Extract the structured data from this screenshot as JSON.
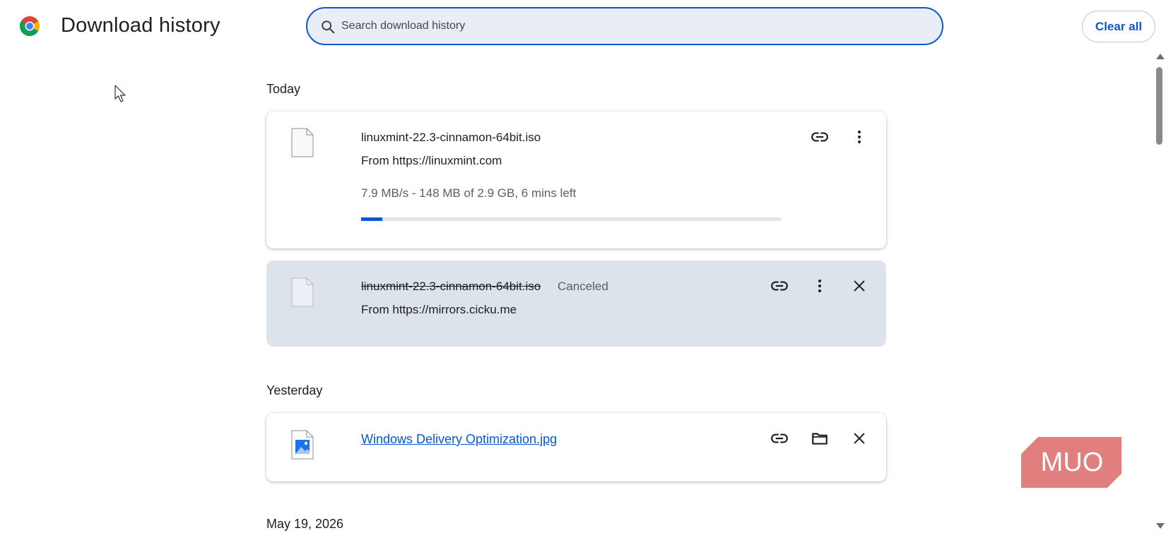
{
  "header": {
    "title": "Download history",
    "search_placeholder": "Search download history",
    "clear_all_label": "Clear all"
  },
  "sections": [
    {
      "title": "Today",
      "items": [
        {
          "file_name": "linuxmint-22.3-cinnamon-64bit.iso",
          "from": "From https://linuxmint.com",
          "progress_text": "7.9 MB/s - 148 MB of 2.9 GB, 6 mins left",
          "progress_fraction": 0.05,
          "actions": [
            "link-icon",
            "more-vert-icon"
          ]
        },
        {
          "file_name": "linuxmint-22.3-cinnamon-64bit.iso",
          "status": "Canceled",
          "from": "From https://mirrors.cicku.me",
          "actions": [
            "link-icon",
            "more-vert-icon",
            "close-icon"
          ]
        }
      ]
    },
    {
      "title": "Yesterday",
      "items": [
        {
          "file_name": "Windows Delivery Optimization.jpg",
          "actions": [
            "link-icon",
            "folder-icon",
            "close-icon"
          ]
        }
      ]
    },
    {
      "title": "May 19, 2026"
    }
  ],
  "colors": {
    "accent": "#0b57d0",
    "search_bg": "#e9eef6",
    "canceled_bg": "#dde3ea",
    "watermark": "#e07f7d"
  },
  "watermark_text": "MUO"
}
